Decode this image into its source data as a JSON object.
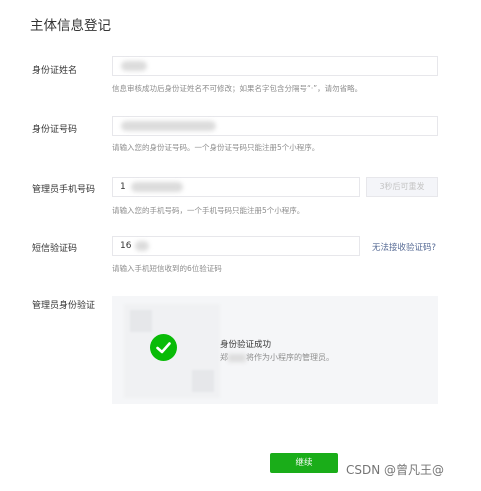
{
  "page": {
    "title": "主体信息登记"
  },
  "form": {
    "id_name": {
      "label": "身份证姓名",
      "value": "",
      "hint": "信息审核成功后身份证姓名不可修改；如果名字包含分隔号“·”，请勿省略。"
    },
    "id_number": {
      "label": "身份证号码",
      "value": "",
      "hint": "请输入您的身份证号码。一个身份证号码只能注册5个小程序。"
    },
    "phone": {
      "label": "管理员手机号码",
      "value": "1",
      "hint": "请输入您的手机号码，一个手机号码只能注册5个小程序。",
      "send_button": "3秒后可重发"
    },
    "sms_code": {
      "label": "短信验证码",
      "value": "16",
      "hint": "请输入手机短信收到的6位验证码",
      "link": "无法接收验证码?"
    },
    "admin_verify": {
      "label": "管理员身份验证",
      "status_title": "身份验证成功",
      "status_desc_prefix": "郑",
      "status_desc_suffix": "将作为小程序的管理员。"
    }
  },
  "actions": {
    "continue_label": "继续"
  },
  "watermark": "CSDN @曾凡王@",
  "colors": {
    "primary_green": "#1aad19",
    "link_blue": "#576b95",
    "success_green": "#09bb07"
  }
}
